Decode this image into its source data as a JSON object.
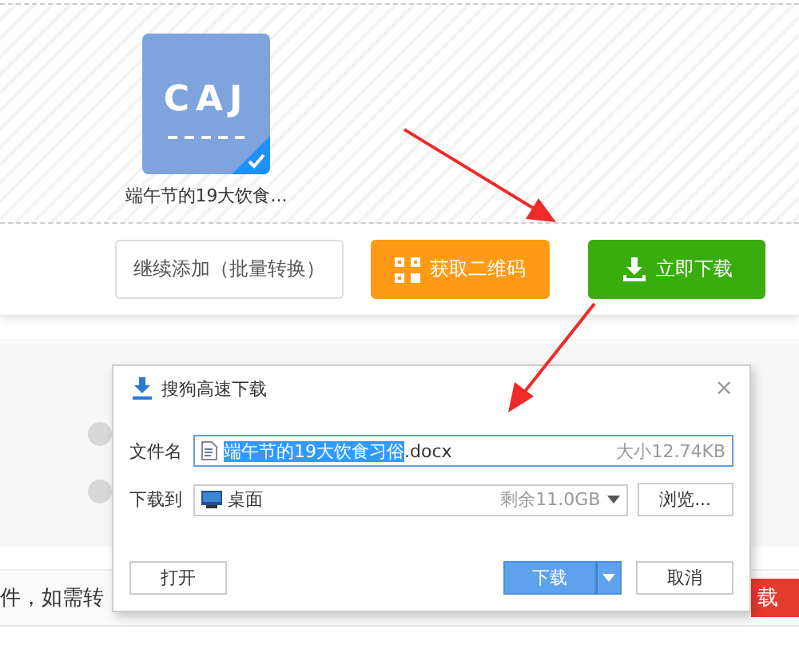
{
  "file_card": {
    "icon_text": "CAJ",
    "checked": true,
    "name": "端午节的19大饮食..."
  },
  "actions": [
    {
      "kind": "outline",
      "label": "继续添加（批量转换）"
    },
    {
      "kind": "qr",
      "label": "获取二维码"
    },
    {
      "kind": "download",
      "label": "立即下载"
    }
  ],
  "background": {
    "notice": "件，如需转",
    "red_button": "载",
    "radios": [
      {
        "selected": false
      },
      {
        "selected": false
      }
    ]
  },
  "dialog": {
    "title": "搜狗高速下载",
    "close": "×",
    "file_label": "文件名",
    "file_selected": "端午节的19大饮食习俗",
    "file_rest": ".docx",
    "file_size": "大小12.74KB",
    "dest_label": "下载到",
    "dest_value": "桌面",
    "dest_free": "剩余11.0GB",
    "browse": "浏览...",
    "open": "打开",
    "download": "下载",
    "cancel": "取消"
  }
}
